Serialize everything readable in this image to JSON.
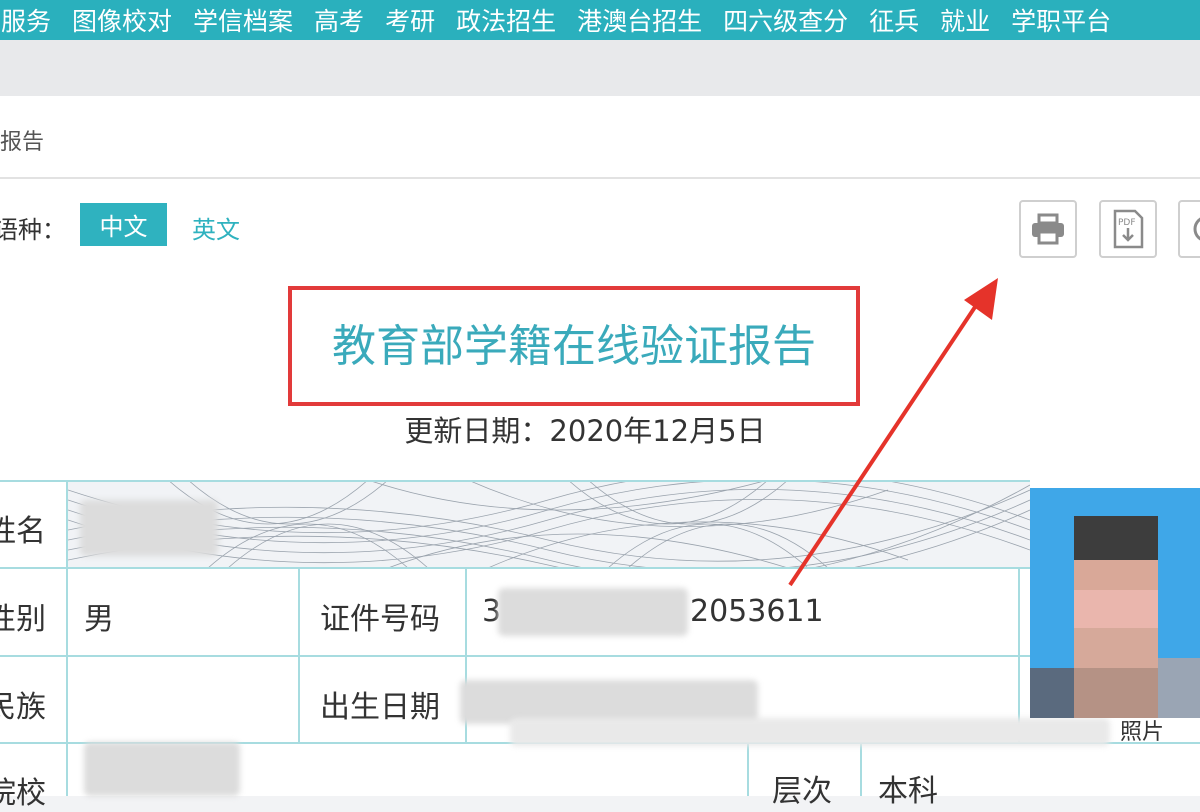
{
  "nav": {
    "items": [
      "录服务",
      "图像校对",
      "学信档案",
      "高考",
      "考研",
      "政法招生",
      "港澳台招生",
      "四六级查分",
      "征兵",
      "就业",
      "学职平台"
    ]
  },
  "breadcrumb": "报告",
  "language": {
    "label": "语种：",
    "options": [
      {
        "label": "中文",
        "active": true
      },
      {
        "label": "英文",
        "active": false
      }
    ]
  },
  "toolbar": {
    "buttons": [
      {
        "icon": "printer-icon"
      },
      {
        "icon": "pdf-download-icon",
        "text": "PDF"
      },
      {
        "icon": "share-icon"
      }
    ]
  },
  "report": {
    "title": "教育部学籍在线验证报告",
    "update_date": "更新日期：2020年12月5日"
  },
  "fields": {
    "name_label": "姓名",
    "gender_label": "性别",
    "gender_value": "男",
    "id_label": "证件号码",
    "id_prefix": "3",
    "id_suffix": "2053611",
    "ethnicity_label": "民族",
    "birth_label": "出生日期",
    "school_label": "院校",
    "level_label": "层次",
    "level_value": "本科",
    "photo_label": "照片"
  },
  "colors": {
    "nav_bg": "#2ab0bd",
    "accent": "#2fb2bf",
    "title": "#3aaabb",
    "highlight_box": "#e23a3a",
    "table_border": "#a7dce0"
  }
}
